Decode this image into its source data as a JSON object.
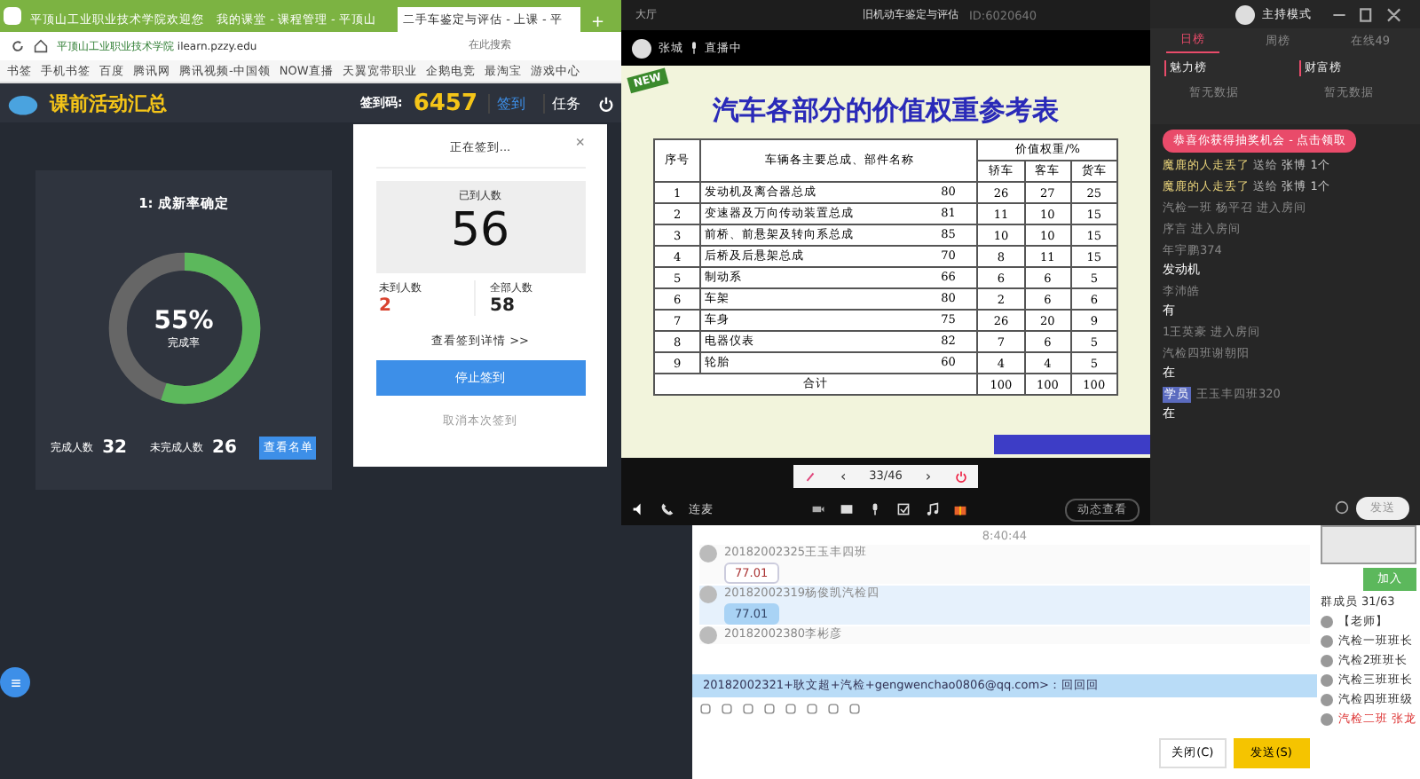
{
  "browser": {
    "tabs": [
      {
        "label": "平顶山工业职业技术学院欢迎您",
        "selected": false
      },
      {
        "label": "我的课堂 - 课程管理 - 平顶山",
        "selected": false
      },
      {
        "label": "二手车鉴定与评估 - 上课 - 平",
        "selected": true
      }
    ],
    "new_tab": "+",
    "address": {
      "site": "平顶山工业职业技术学院",
      "url": "ilearn.pzzy.edu"
    },
    "search": {
      "placeholder": "在此搜索"
    },
    "bookmarks": [
      "书签",
      "手机书签",
      "百度",
      "腾讯网",
      "腾讯视频-中国领",
      "NOW直播",
      "天翼宽带职业",
      "企鹅电竞",
      "最淘宝",
      "游戏中心"
    ]
  },
  "app_header": {
    "title": "课前活动汇总",
    "code_label": "签到码:",
    "code": "6457",
    "buttons": [
      {
        "label": "签到",
        "selected": true
      },
      {
        "label": "任务",
        "selected": false
      }
    ]
  },
  "activity_card": {
    "title": "1: 成新率确定",
    "percent": "55%",
    "caption": "完成率",
    "level": 0.55,
    "done_label": "完成人数",
    "done": "32",
    "undone_label": "未完成人数",
    "undone": "26",
    "list_button": "查看名单"
  },
  "checkin_popup": {
    "title": "正在签到...",
    "close": "×",
    "arrived_label": "已到人数",
    "arrived": "56",
    "absent_label": "未到人数",
    "absent": "2",
    "total_label": "全部人数",
    "total": "58",
    "details_link": "查看签到详情 >>",
    "stop_button": "停止签到",
    "cancel_link": "取消本次签到"
  },
  "live_room": {
    "lobby": "大厅",
    "title": "旧机动车鉴定与评估",
    "room_id": "ID:6020640",
    "host": "张城",
    "status": "直播中",
    "page": "33/46",
    "prev": "‹",
    "next": "›",
    "phone_label": "连麦",
    "action_button": "动态查看"
  },
  "slide": {
    "badge": "NEW",
    "title": "汽车各部分的价值权重参考表",
    "table": {
      "columns": [
        "序号",
        "车辆各主要总成、部件名称",
        "价值权重/%"
      ],
      "sub_columns": [
        "轿车",
        "客车",
        "货车"
      ],
      "rows": [
        {
          "no": "1",
          "name": "发动机及离合器总成",
          "score": "80",
          "values": [
            "26",
            "27",
            "25"
          ]
        },
        {
          "no": "2",
          "name": "变速器及万向传动装置总成",
          "score": "81",
          "values": [
            "11",
            "10",
            "15"
          ]
        },
        {
          "no": "3",
          "name": "前桥、前悬架及转向系总成",
          "score": "85",
          "values": [
            "10",
            "10",
            "15"
          ]
        },
        {
          "no": "4",
          "name": "后桥及后悬架总成",
          "score": "70",
          "values": [
            "8",
            "11",
            "15"
          ]
        },
        {
          "no": "5",
          "name": "制动系",
          "score": "66",
          "values": [
            "6",
            "6",
            "5"
          ]
        },
        {
          "no": "6",
          "name": "车架",
          "score": "80",
          "values": [
            "2",
            "6",
            "6"
          ]
        },
        {
          "no": "7",
          "name": "车身",
          "score": "75",
          "values": [
            "26",
            "20",
            "9"
          ]
        },
        {
          "no": "8",
          "name": "电器仪表",
          "score": "82",
          "values": [
            "7",
            "6",
            "5"
          ]
        },
        {
          "no": "9",
          "name": "轮胎",
          "score": "60",
          "values": [
            "4",
            "4",
            "5"
          ]
        }
      ],
      "total": [
        "合计",
        "100",
        "100",
        "100"
      ]
    }
  },
  "side_panel": {
    "mode": "主持模式",
    "tabs": [
      {
        "label": "日榜",
        "selected": true
      },
      {
        "label": "周榜",
        "selected": false
      },
      {
        "label": "在线49",
        "selected": false
      }
    ],
    "boards": [
      {
        "title": "魅力榜",
        "empty": "暂无数据"
      },
      {
        "title": "财富榜",
        "empty": "暂无数据"
      }
    ],
    "notice": "恭喜你获得抽奖机会 - 点击领取",
    "messages": [
      {
        "kind": "gift",
        "user": "魔鹿的人走丢了",
        "action": "送给",
        "target": "张博",
        "count": "1个"
      },
      {
        "kind": "gift",
        "user": "魔鹿的人走丢了",
        "action": "送给",
        "target": "张博",
        "count": "1个"
      },
      {
        "kind": "enter",
        "text": "汽检一班 杨平召 进入房间"
      },
      {
        "kind": "enter",
        "text": "序言 进入房间"
      },
      {
        "kind": "chat",
        "user": "年宇鹏374",
        "text": "发动机"
      },
      {
        "kind": "chat",
        "user": "李沛皓",
        "text": "有"
      },
      {
        "kind": "enter",
        "text": "1王英豪 进入房间"
      },
      {
        "kind": "chat",
        "user": "汽检四班谢朝阳",
        "text": "在"
      },
      {
        "kind": "chat",
        "badge": "学员",
        "user": "王玉丰四班320",
        "text": "在"
      }
    ],
    "send_button": "发送"
  },
  "group_chat": {
    "time": "8:40:44",
    "messages": [
      {
        "user": "20182002325王玉丰四班",
        "text": "77.01",
        "selected": false
      },
      {
        "user": "20182002319杨俊凯汽检四",
        "text": "77.01",
        "selected": true
      },
      {
        "user": "20182002380李彬彦"
      }
    ],
    "notice": "20182002321+耿文超+汽检+gengwenchao0806@qq.com>：回回回",
    "close_button": "关闭(C)",
    "send_button": "发送(S)"
  },
  "members": {
    "join_button": "加入",
    "title": "群成员 31/63",
    "list": [
      {
        "name": "【老师】"
      },
      {
        "name": "汽检一班班长"
      },
      {
        "name": "汽检2班班长"
      },
      {
        "name": "汽检三班班长"
      },
      {
        "name": "汽检四班班级"
      }
    ],
    "current": "汽检二班 张龙"
  }
}
